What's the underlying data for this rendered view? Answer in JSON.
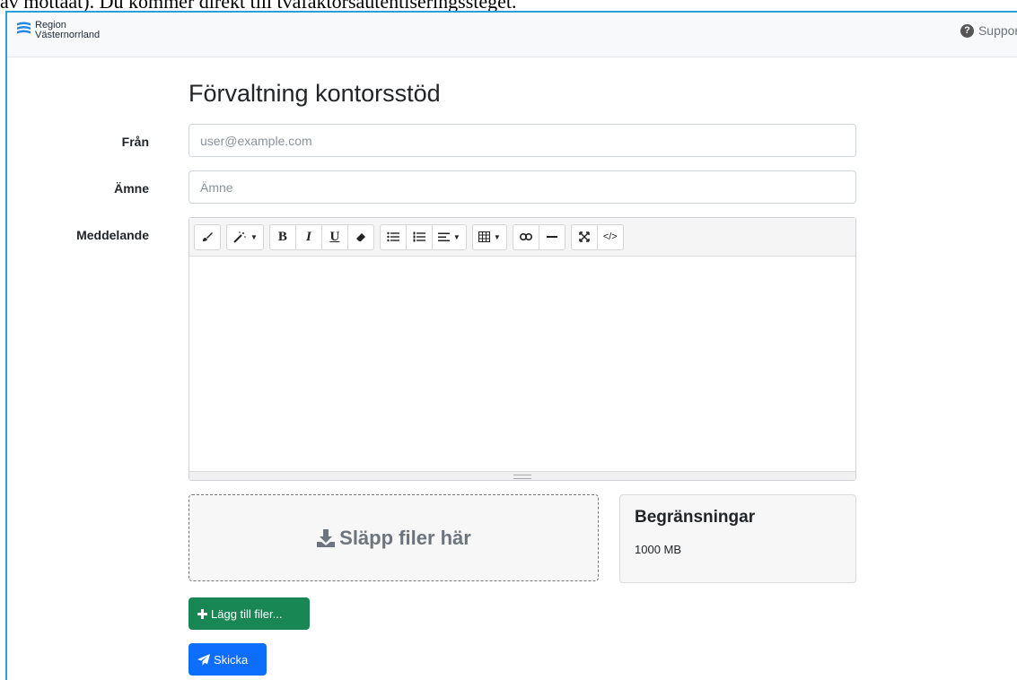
{
  "background_text": "av mottaat). Du kommer direkt till tvåfaktorsautentiseringssteget.",
  "navbar": {
    "logo_line1": "Region",
    "logo_line2": "Västernorrland",
    "support_label": "Support"
  },
  "page": {
    "title": "Förvaltning kontorsstöd"
  },
  "form": {
    "from_label": "Från",
    "from_placeholder": "user@example.com",
    "subject_label": "Ämne",
    "subject_placeholder": "Ämne",
    "message_label": "Meddelande"
  },
  "editor": {
    "toolbar_icons": [
      "paintbrush-icon",
      "magic-icon",
      "bold-icon",
      "italic-icon",
      "underline-icon",
      "eraser-icon",
      "unordered-list-icon",
      "ordered-list-icon",
      "align-icon",
      "table-icon",
      "link-icon",
      "horizontal-rule-icon",
      "fullscreen-icon",
      "code-view-icon"
    ],
    "bold": "B",
    "italic": "I",
    "underline": "U",
    "code": "</>"
  },
  "dropzone": {
    "label": "Släpp filer här"
  },
  "limits": {
    "title": "Begränsningar",
    "value": "1000 MB"
  },
  "buttons": {
    "add_files": "Lägg till filer...",
    "send": "Skicka"
  },
  "colors": {
    "frame_border": "#2a9fd8",
    "add_button": "#198754",
    "send_button": "#0d6efd",
    "logo": "#1e88e5"
  }
}
